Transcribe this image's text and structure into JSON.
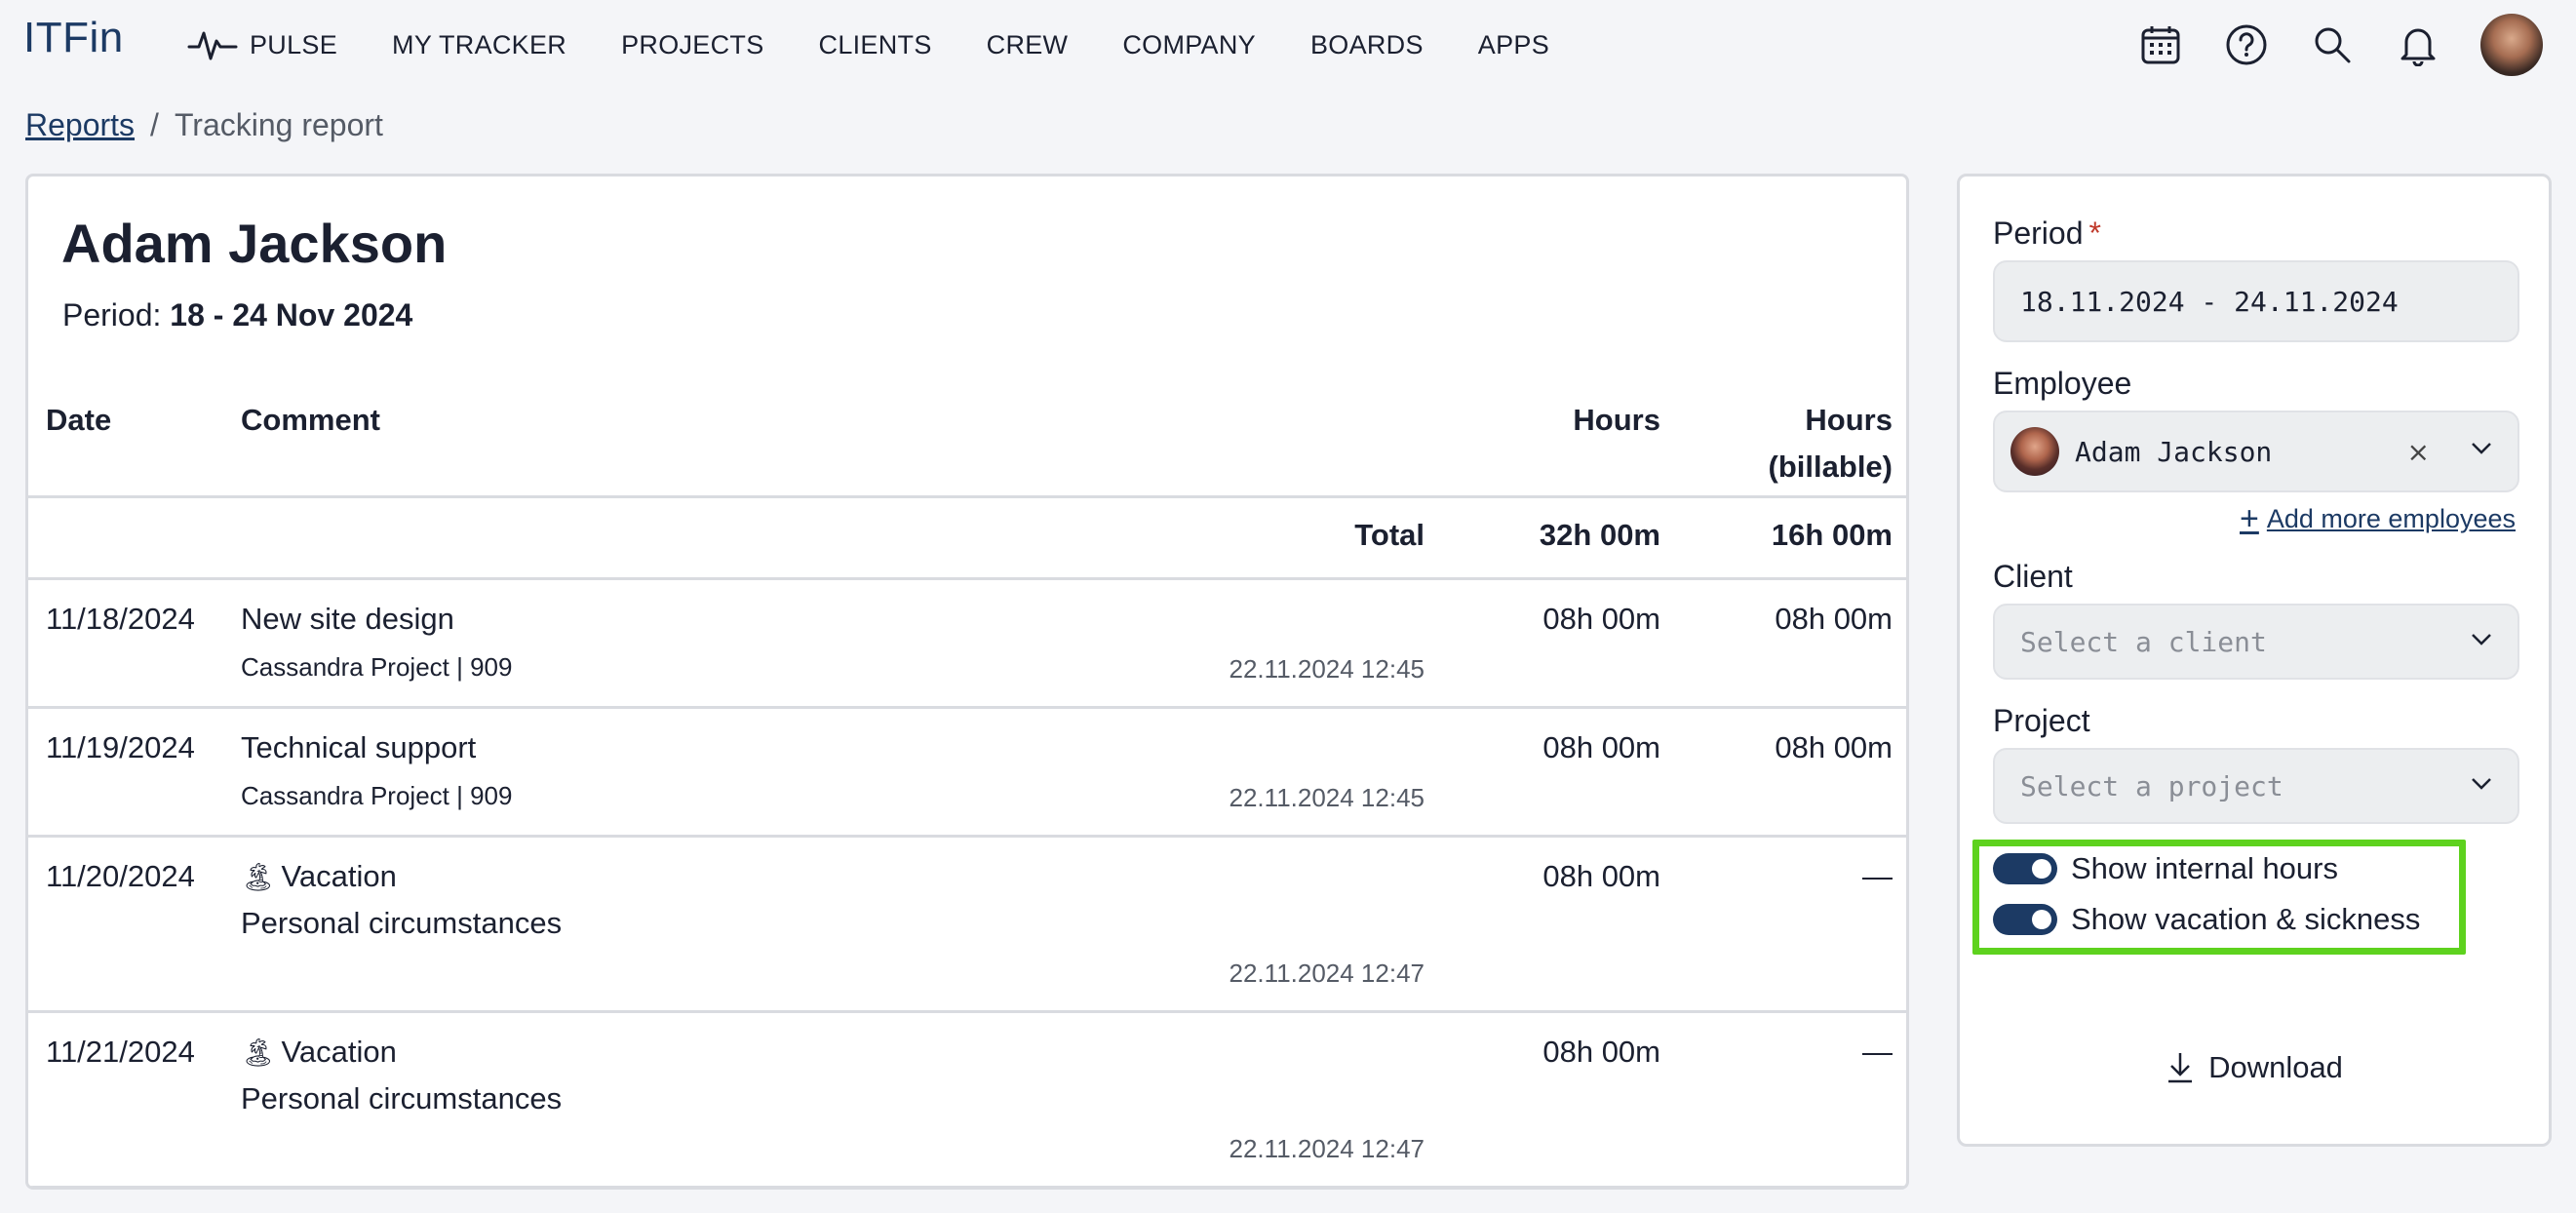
{
  "app": {
    "logo": "ITFin"
  },
  "nav": {
    "items": [
      {
        "label": "PULSE",
        "icon": "pulse-icon"
      },
      {
        "label": "MY TRACKER"
      },
      {
        "label": "PROJECTS"
      },
      {
        "label": "CLIENTS"
      },
      {
        "label": "CREW"
      },
      {
        "label": "COMPANY"
      },
      {
        "label": "BOARDS"
      },
      {
        "label": "APPS"
      }
    ],
    "icons": [
      "calendar-icon",
      "help-icon",
      "search-icon",
      "bell-icon",
      "avatar"
    ]
  },
  "breadcrumb": {
    "parent": "Reports",
    "separator": "/",
    "current": "Tracking report"
  },
  "report": {
    "name": "Adam Jackson",
    "period_label": "Period:",
    "period_value": "18 - 24 Nov 2024",
    "columns": {
      "date": "Date",
      "comment": "Comment",
      "hours": "Hours",
      "billable_line1": "Hours",
      "billable_line2": "(billable)"
    },
    "total": {
      "label": "Total",
      "hours": "32h 00m",
      "billable": "16h 00m"
    },
    "rows": [
      {
        "date": "11/18/2024",
        "title": "New site design",
        "sub": "Cassandra Project | 909",
        "stamp": "22.11.2024 12:45",
        "hours": "08h 00m",
        "billable": "08h 00m"
      },
      {
        "date": "11/19/2024",
        "title": "Technical support",
        "sub": "Cassandra Project | 909",
        "stamp": "22.11.2024 12:45",
        "hours": "08h 00m",
        "billable": "08h 00m"
      },
      {
        "date": "11/20/2024",
        "emoji": "🏝",
        "title": "Vacation",
        "sub": "Personal circumstances",
        "stamp": "22.11.2024 12:47",
        "hours": "08h 00m",
        "billable": "—"
      },
      {
        "date": "11/21/2024",
        "emoji": "🏝",
        "title": "Vacation",
        "sub": "Personal circumstances",
        "stamp": "22.11.2024 12:47",
        "hours": "08h 00m",
        "billable": "—"
      }
    ]
  },
  "filters": {
    "period_label": "Period",
    "required_mark": "*",
    "period_value": "18.11.2024 - 24.11.2024",
    "employee_label": "Employee",
    "employee_value": "Adam Jackson",
    "clear_glyph": "×",
    "add_more": "Add more employees",
    "add_more_plus": "+",
    "client_label": "Client",
    "client_placeholder": "Select a client",
    "project_label": "Project",
    "project_placeholder": "Select a project",
    "toggle_internal": "Show internal hours",
    "toggle_internal_on": true,
    "toggle_vacation": "Show vacation & sickness",
    "toggle_vacation_on": true,
    "download": "Download"
  },
  "colors": {
    "brand": "#1c3a64",
    "highlight": "#5ed21e",
    "required": "#c0392b"
  }
}
